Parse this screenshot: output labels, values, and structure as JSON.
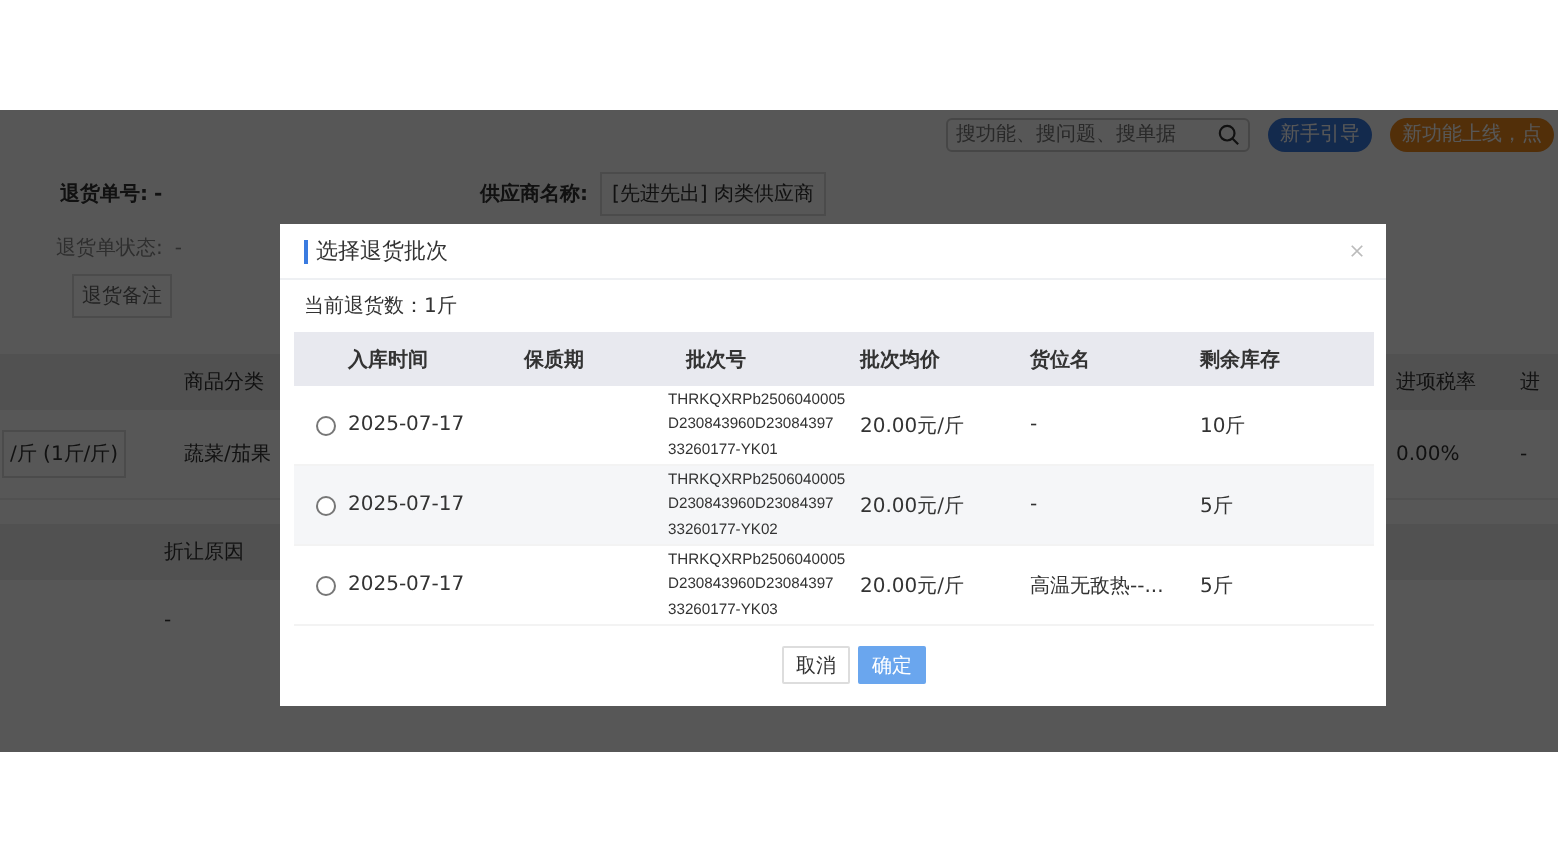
{
  "top_bar": {
    "search": {
      "placeholder": "搜功能、搜问题、搜单据"
    },
    "buttons": [
      {
        "label": "新手引导",
        "kind": "guide"
      },
      {
        "label": "新功能上线，点",
        "kind": "promo"
      }
    ]
  },
  "form": {
    "fields": [
      {
        "label": "退货单号:",
        "value": "-",
        "kind": "plain"
      },
      {
        "label": "供应商名称:",
        "value": "[先进先出] 肉类供应商",
        "kind": "boxed"
      },
      {
        "label": "退货单状态:",
        "value": "-",
        "kind": "muted"
      }
    ],
    "remark_label": "退货备注"
  },
  "goods_table": {
    "columns": [
      "商品分类",
      "进项税率",
      "进"
    ],
    "row": [
      "/斤 (1斤/斤)",
      "蔬菜/茄果",
      "0.00%",
      "-"
    ]
  },
  "discount_table": {
    "columns": [
      "折让原因"
    ],
    "row": [
      "-"
    ]
  },
  "dialog": {
    "title": "选择退货批次",
    "current_qty": "当前退货数：1斤",
    "columns": [
      "入库时间",
      "保质期",
      "批次号",
      "批次均价",
      "货位名",
      "剩余库存"
    ],
    "rows": [
      {
        "selected": false,
        "date": "2025-07-17",
        "batch": [
          "THRKQXRPb2506040005",
          "D230843960D23084397",
          "33260177-YK01"
        ],
        "price": "20.00元/斤",
        "location": "-",
        "stock": "10斤"
      },
      {
        "selected": false,
        "date": "2025-07-17",
        "batch": [
          "THRKQXRPb2506040005",
          "D230843960D23084397",
          "33260177-YK02"
        ],
        "price": "20.00元/斤",
        "location": "-",
        "stock": "5斤"
      },
      {
        "selected": false,
        "date": "2025-07-17",
        "batch": [
          "THRKQXRPb2506040005",
          "D230843960D23084397",
          "33260177-YK03"
        ],
        "price": "20.00元/斤",
        "location": "高温无敌热--...",
        "stock": "5斤"
      }
    ],
    "buttons": [
      {
        "label": "取消",
        "kind": "default"
      },
      {
        "label": "确定",
        "kind": "primary"
      }
    ]
  }
}
